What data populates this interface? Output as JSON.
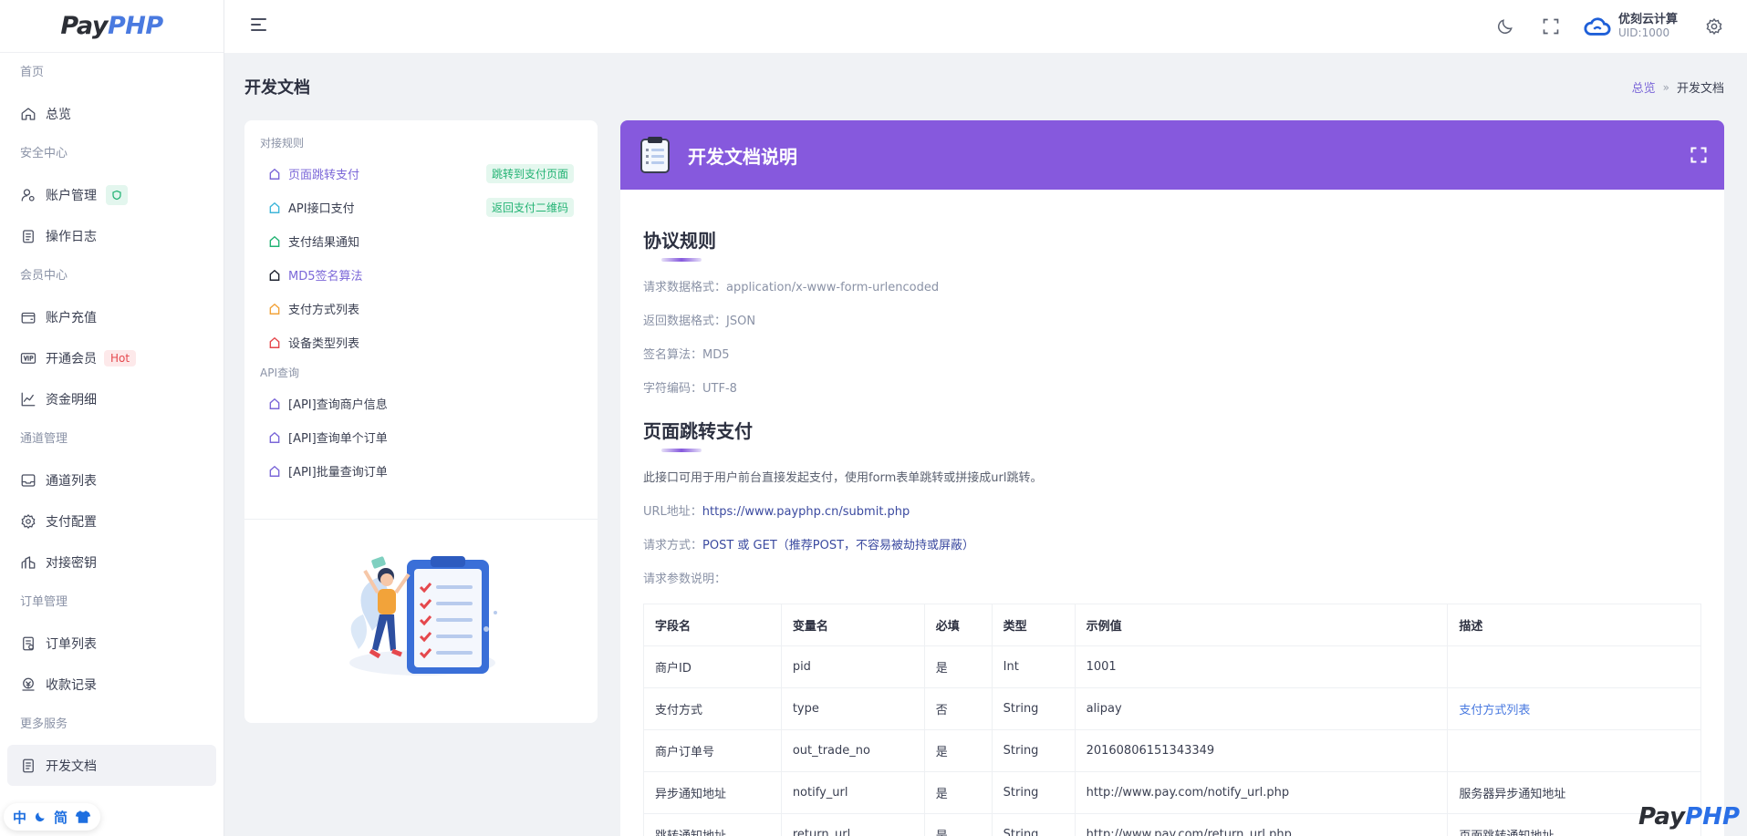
{
  "brand": {
    "pay": "Pay",
    "php": "PHP"
  },
  "sidebar": {
    "items": [
      {
        "type": "group",
        "label": "首页"
      },
      {
        "type": "item",
        "label": "总览",
        "icon": "home-icon"
      },
      {
        "type": "group",
        "label": "安全中心"
      },
      {
        "type": "item",
        "label": "账户管理",
        "icon": "user-settings-icon",
        "badge": "shield-icon"
      },
      {
        "type": "item",
        "label": "操作日志",
        "icon": "log-icon"
      },
      {
        "type": "group",
        "label": "会员中心"
      },
      {
        "type": "item",
        "label": "账户充值",
        "icon": "wallet-icon"
      },
      {
        "type": "item",
        "label": "开通会员",
        "icon": "vip-icon",
        "tag": "Hot"
      },
      {
        "type": "item",
        "label": "资金明细",
        "icon": "chart-line-icon"
      },
      {
        "type": "group",
        "label": "通道管理"
      },
      {
        "type": "item",
        "label": "通道列表",
        "icon": "inbox-icon"
      },
      {
        "type": "item",
        "label": "支付配置",
        "icon": "gear-icon"
      },
      {
        "type": "item",
        "label": "对接密钥",
        "icon": "key-icon"
      },
      {
        "type": "group",
        "label": "订单管理"
      },
      {
        "type": "item",
        "label": "订单列表",
        "icon": "order-list-icon"
      },
      {
        "type": "item",
        "label": "收款记录",
        "icon": "money-icon"
      },
      {
        "type": "group",
        "label": "更多服务"
      },
      {
        "type": "item",
        "label": "开发文档",
        "icon": "document-icon",
        "active": true
      }
    ],
    "lang_pill": {
      "lang": "中",
      "simplified": "简"
    }
  },
  "header": {
    "user_name": "优刻云计算",
    "user_uid": "UID:1000"
  },
  "page": {
    "title": "开发文档",
    "breadcrumb": [
      "总览",
      "开发文档"
    ]
  },
  "doc_nav": {
    "group1": "对接规则",
    "items1": [
      {
        "label": "页面跳转支付",
        "color": "#7b67d8",
        "tag": "跳转到支付页面",
        "link": true
      },
      {
        "label": "API接口支付",
        "color": "#3fb6d9",
        "tag": "返回支付二维码"
      },
      {
        "label": "支付结果通知",
        "color": "#23b374"
      },
      {
        "label": "MD5签名算法",
        "color": "#1f2330",
        "link": true
      },
      {
        "label": "支付方式列表",
        "color": "#f2a33a"
      },
      {
        "label": "设备类型列表",
        "color": "#e5484d"
      }
    ],
    "group2": "API查询",
    "items2": [
      {
        "label": "[API]查询商户信息",
        "color": "#7b67d8"
      },
      {
        "label": "[API]查询单个订单",
        "color": "#7b67d8"
      },
      {
        "label": "[API]批量查询订单",
        "color": "#7b67d8"
      }
    ]
  },
  "main": {
    "header_title": "开发文档说明",
    "section1": {
      "title": "协议规则",
      "rows": [
        {
          "k": "请求数据格式：",
          "v": "application/x-www-form-urlencoded"
        },
        {
          "k": "返回数据格式：",
          "v": "JSON"
        },
        {
          "k": "签名算法：",
          "v": "MD5"
        },
        {
          "k": "字符编码：",
          "v": "UTF-8"
        }
      ]
    },
    "section2": {
      "title": "页面跳转支付",
      "desc": "此接口可用于用户前台直接发起支付，使用form表单跳转或拼接成url跳转。",
      "url_label": "URL地址：",
      "url": "https://www.payphp.cn/submit.php",
      "method_label": "请求方式：",
      "method": "POST 或 GET（推荐POST，不容易被劫持或屏蔽）",
      "params_label": "请求参数说明："
    },
    "table": {
      "headers": [
        "字段名",
        "变量名",
        "必填",
        "类型",
        "示例值",
        "描述"
      ],
      "rows": [
        [
          "商户ID",
          "pid",
          "是",
          "Int",
          "1001",
          ""
        ],
        [
          "支付方式",
          "type",
          "否",
          "String",
          "alipay",
          "支付方式列表"
        ],
        [
          "商户订单号",
          "out_trade_no",
          "是",
          "String",
          "20160806151343349",
          ""
        ],
        [
          "异步通知地址",
          "notify_url",
          "是",
          "String",
          "http://www.pay.com/notify_url.php",
          "服务器异步通知地址"
        ],
        [
          "跳转通知地址",
          "return_url",
          "是",
          "String",
          "http://www.pay.com/return_url.php",
          "页面跳转通知地址"
        ]
      ]
    }
  }
}
